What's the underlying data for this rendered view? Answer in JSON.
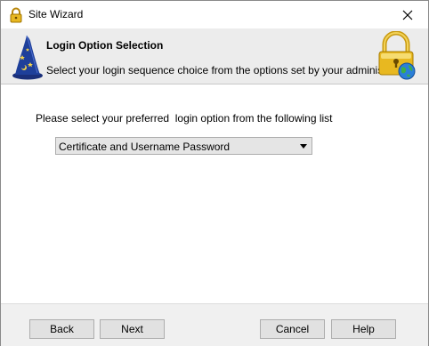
{
  "window": {
    "title": "Site Wizard",
    "title_icon": "lock-icon",
    "close_icon": "close-icon"
  },
  "header": {
    "title": "Login Option Selection",
    "subtitle": "Select your login sequence choice from the options set by your administrator",
    "left_icon": "wizard-hat-icon",
    "right_icon": "padlock-globe-icon"
  },
  "content": {
    "prompt": "Please select your preferred  login option from the following list",
    "login_option": {
      "selected": "Certificate and Username Password"
    }
  },
  "buttons": {
    "back": "Back",
    "next": "Next",
    "cancel": "Cancel",
    "help": "Help"
  },
  "colors": {
    "lock_gold": "#e8b820",
    "wizard_blue": "#1e3f9a",
    "globe_blue": "#2b7fd8"
  }
}
